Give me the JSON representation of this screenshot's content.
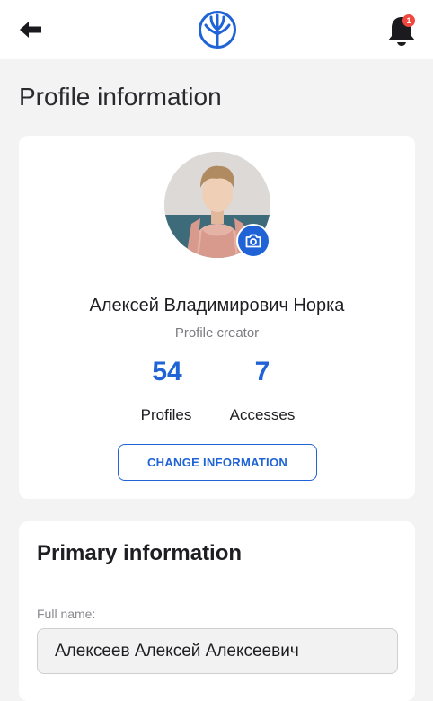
{
  "header": {
    "back_icon": "arrow-left-icon",
    "logo_icon": "tree-logo-icon",
    "notifications_icon": "bell-icon",
    "notifications_count": "1"
  },
  "page": {
    "title": "Profile information"
  },
  "profile": {
    "name": "Алексей Владимирович Норка",
    "role": "Profile creator",
    "stats": [
      {
        "value": "54",
        "label": "Profiles"
      },
      {
        "value": "7",
        "label": "Accesses"
      }
    ],
    "change_button_label": "CHANGE INFORMATION",
    "camera_icon": "camera-icon"
  },
  "primary_info": {
    "title": "Primary information",
    "full_name_label": "Full name:",
    "full_name_value": "Алексеев Алексей Алексеевич"
  },
  "colors": {
    "accent": "#1f63d6",
    "badge": "#f0473f",
    "background": "#f3f3f4"
  }
}
